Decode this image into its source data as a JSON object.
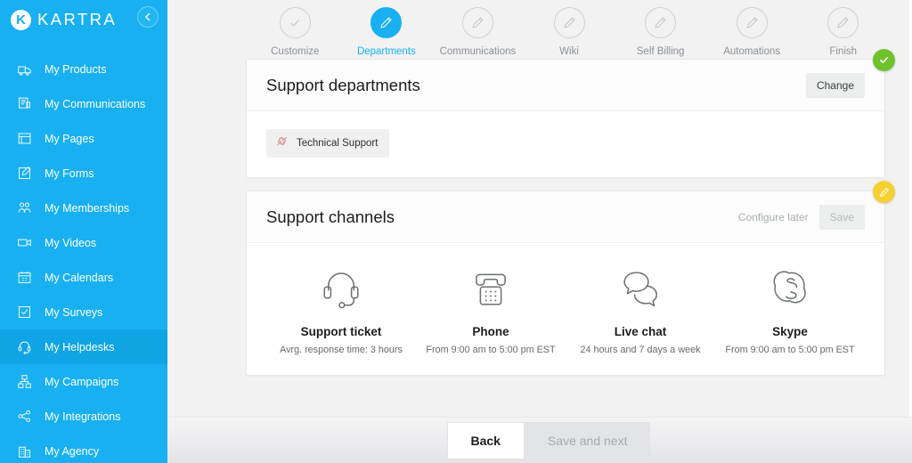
{
  "brand": {
    "logo_letter": "K",
    "logo_text": "KARTRA",
    "accent_color": "#18b0f0",
    "sidebar_color": "#18b0f0",
    "sidebar_active_color": "#0fa5e4"
  },
  "sidebar": {
    "collapse_icon": "chevron-left-icon",
    "items": [
      {
        "label": "My Products",
        "icon": "products-icon",
        "active": false
      },
      {
        "label": "My Communications",
        "icon": "communications-icon",
        "active": false
      },
      {
        "label": "My Pages",
        "icon": "pages-icon",
        "active": false
      },
      {
        "label": "My Forms",
        "icon": "forms-icon",
        "active": false
      },
      {
        "label": "My Memberships",
        "icon": "memberships-icon",
        "active": false
      },
      {
        "label": "My Videos",
        "icon": "videos-icon",
        "active": false
      },
      {
        "label": "My Calendars",
        "icon": "calendars-icon",
        "active": false
      },
      {
        "label": "My Surveys",
        "icon": "surveys-icon",
        "active": false
      },
      {
        "label": "My Helpdesks",
        "icon": "helpdesk-icon",
        "active": true
      },
      {
        "label": "My Campaigns",
        "icon": "campaigns-icon",
        "active": false
      },
      {
        "label": "My Integrations",
        "icon": "integrations-icon",
        "active": false
      },
      {
        "label": "My Agency",
        "icon": "agency-icon",
        "active": false
      }
    ]
  },
  "steps": [
    {
      "label": "Customize",
      "icon": "check-icon",
      "state": "done"
    },
    {
      "label": "Departments",
      "icon": "pencil-icon",
      "state": "current"
    },
    {
      "label": "Communications",
      "icon": "pencil-icon",
      "state": "pending"
    },
    {
      "label": "Wiki",
      "icon": "pencil-icon",
      "state": "pending"
    },
    {
      "label": "Self Billing",
      "icon": "pencil-icon",
      "state": "pending"
    },
    {
      "label": "Automations",
      "icon": "pencil-icon",
      "state": "pending"
    },
    {
      "label": "Finish",
      "icon": "pencil-icon",
      "state": "pending"
    }
  ],
  "departments_card": {
    "title": "Support departments",
    "change_label": "Change",
    "badge": {
      "icon": "check-icon",
      "color": "#6fc22c"
    },
    "tags": [
      {
        "label": "Technical Support",
        "icon": "department-icon",
        "icon_color": "#d98f93"
      }
    ]
  },
  "channels_card": {
    "title": "Support channels",
    "configure_later_label": "Configure later",
    "save_label": "Save",
    "badge": {
      "icon": "pencil-icon",
      "color": "#f5d033"
    },
    "channels": [
      {
        "name": "Support ticket",
        "sub": "Avrg. response time: 3 hours",
        "icon": "headset-icon"
      },
      {
        "name": "Phone",
        "sub": "From 9:00 am to 5:00 pm EST",
        "icon": "telephone-icon"
      },
      {
        "name": "Live chat",
        "sub": "24 hours and 7 days a week",
        "icon": "chat-bubbles-icon"
      },
      {
        "name": "Skype",
        "sub": "From 9:00 am to 5:00 pm EST",
        "icon": "skype-icon"
      }
    ]
  },
  "footer": {
    "back_label": "Back",
    "save_next_label": "Save and next"
  }
}
